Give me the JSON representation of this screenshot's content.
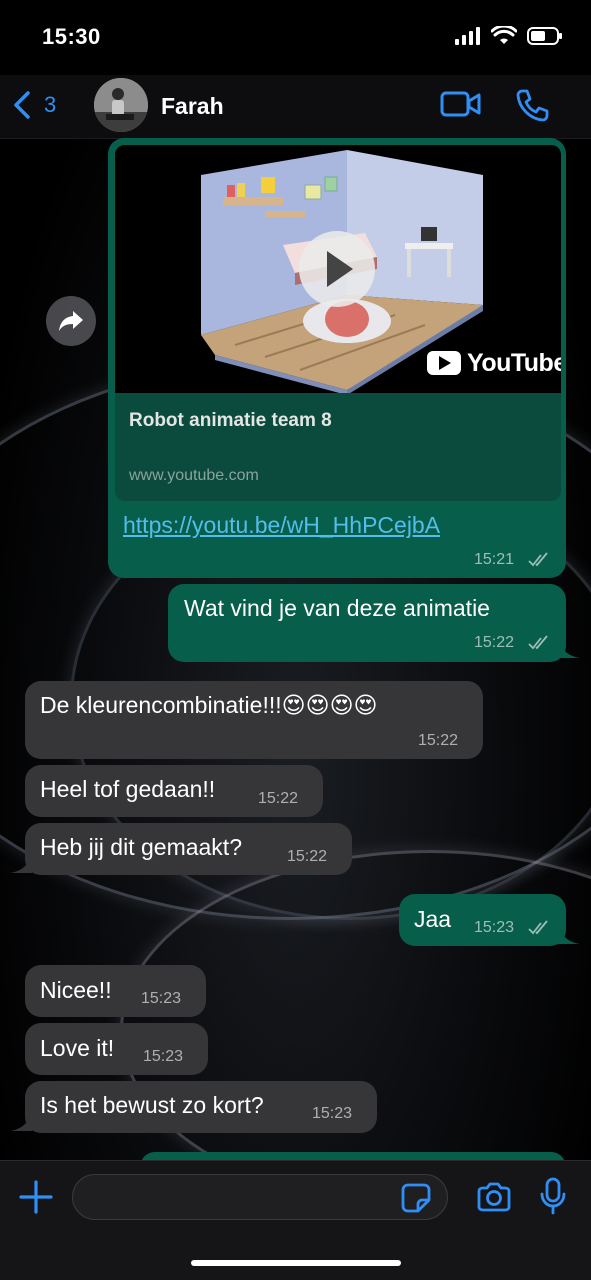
{
  "status_bar": {
    "time": "15:30"
  },
  "header": {
    "back_count": "3",
    "contact_name": "Farah"
  },
  "link_preview": {
    "title": "Robot animatie team 8",
    "domain": "www.youtube.com",
    "brand": "YouTube",
    "url": "https://youtu.be/wH_HhPCejbA",
    "time": "15:21"
  },
  "messages": [
    {
      "text": "Wat vind je van deze animatie",
      "time": "15:22",
      "direction": "outgoing"
    },
    {
      "text": "De kleurencombinatie!!!😍😍😍😍",
      "time": "15:22",
      "direction": "incoming"
    },
    {
      "text": "Heel tof gedaan!!",
      "time": "15:22",
      "direction": "incoming"
    },
    {
      "text": "Heb jij dit gemaakt?",
      "time": "15:22",
      "direction": "incoming"
    },
    {
      "text": "Jaa",
      "time": "15:23",
      "direction": "outgoing"
    },
    {
      "text": "Nicee!!",
      "time": "15:23",
      "direction": "incoming"
    },
    {
      "text": "Love it!",
      "time": "15:23",
      "direction": "incoming"
    },
    {
      "text": "Is het bewust zo kort?",
      "time": "15:23",
      "direction": "incoming"
    }
  ],
  "input": {
    "placeholder": ""
  },
  "colors": {
    "accent": "#2f8ff4",
    "outgoing_bubble": "#075e4b",
    "incoming_bubble": "#363638",
    "link": "#53bdeb"
  },
  "icons": [
    "chevron-left-icon",
    "video-camera-icon",
    "phone-icon",
    "forward-icon",
    "play-icon",
    "youtube-logo-icon",
    "double-check-icon",
    "plus-icon",
    "sticker-icon",
    "camera-icon",
    "microphone-icon",
    "signal-icon",
    "wifi-icon",
    "battery-icon"
  ]
}
